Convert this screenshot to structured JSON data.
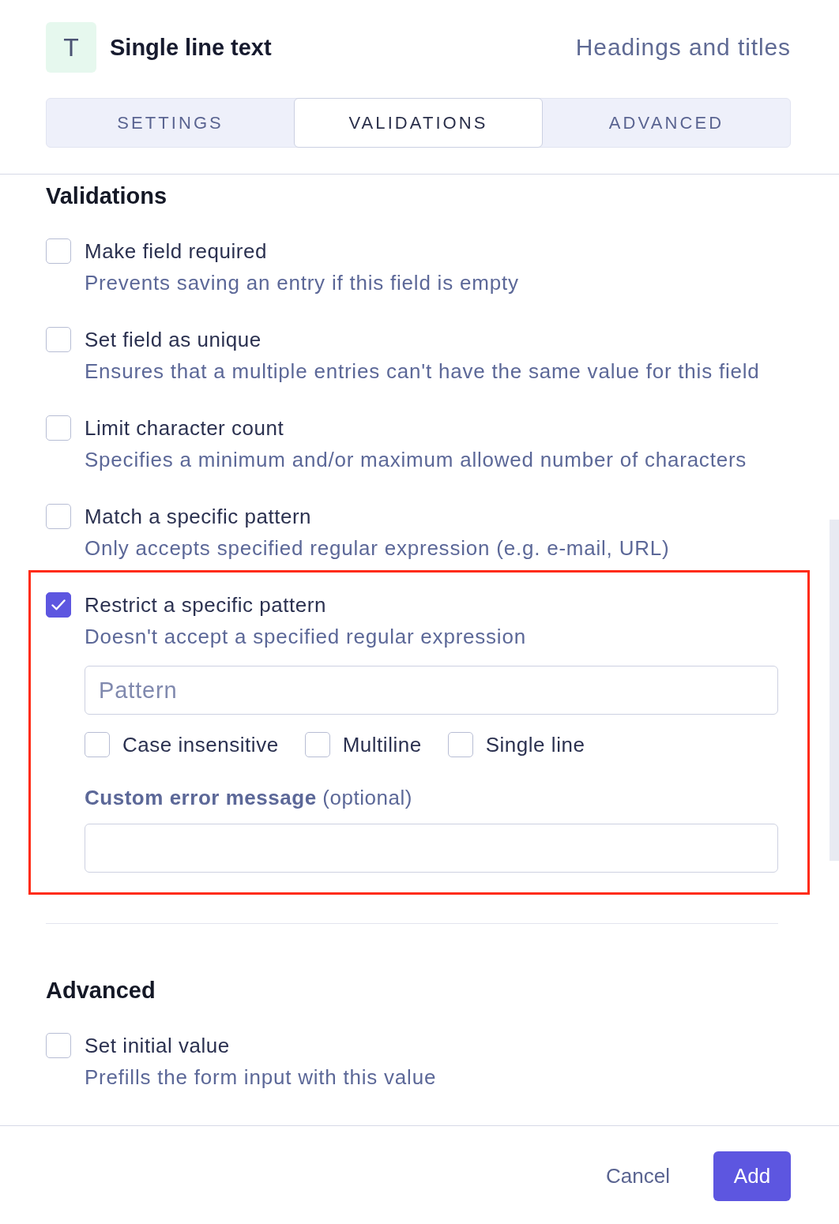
{
  "field_type": {
    "icon_letter": "T",
    "name": "Single line text",
    "category": "Headings and titles"
  },
  "tabs": [
    {
      "label": "SETTINGS",
      "selected": false
    },
    {
      "label": "VALIDATIONS",
      "selected": true
    },
    {
      "label": "ADVANCED",
      "selected": false
    }
  ],
  "sections": [
    {
      "title": "Validations",
      "options": [
        {
          "label": "Make field required",
          "description": "Prevents saving an entry if this field is empty",
          "checked": false,
          "highlighted": false
        },
        {
          "label": "Set field as unique",
          "description": "Ensures that a multiple entries can't have the same value for this field",
          "checked": false,
          "highlighted": false
        },
        {
          "label": "Limit character count",
          "description": "Specifies a minimum and/or maximum allowed number of characters",
          "checked": false,
          "highlighted": false
        },
        {
          "label": "Match a specific pattern",
          "description": "Only accepts specified regular expression (e.g. e-mail, URL)",
          "checked": false,
          "highlighted": false
        },
        {
          "label": "Restrict a specific pattern",
          "description": "Doesn't accept a specified regular expression",
          "checked": true,
          "highlighted": true,
          "pattern_field": {
            "placeholder": "Pattern"
          },
          "flags": [
            {
              "label": "Case insensitive",
              "checked": false
            },
            {
              "label": "Multiline",
              "checked": false
            },
            {
              "label": "Single line",
              "checked": false
            }
          ],
          "error_message_field": {
            "label": "**Custom error message** (optional)"
          }
        }
      ]
    },
    {
      "title": "Advanced",
      "options": [
        {
          "label": "Set initial value",
          "description": "Prefills the form input with this value",
          "checked": false,
          "highlighted": false
        }
      ]
    }
  ],
  "buttons": [
    {
      "label": "Cancel",
      "kind": "cancel"
    },
    {
      "label": "Add",
      "kind": "confirm"
    }
  ]
}
